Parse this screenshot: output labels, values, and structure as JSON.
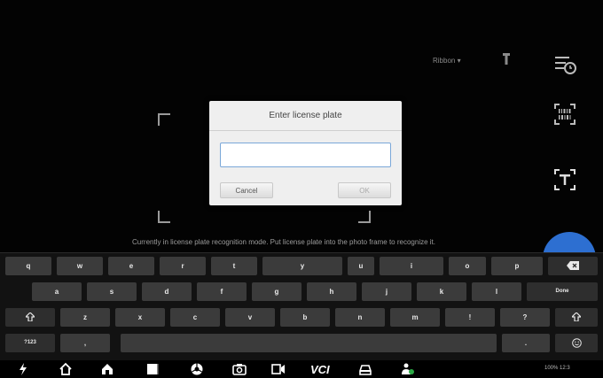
{
  "camera": {
    "mode_label": "Ribbon ▾",
    "hint": "Currently in license plate recognition mode. Put license plate into the photo frame to recognize it."
  },
  "dialog": {
    "title": "Enter license plate",
    "input_value": "",
    "input_placeholder": "",
    "cancel_label": "Cancel",
    "ok_label": "OK"
  },
  "keyboard": {
    "row1": [
      "q",
      "w",
      "e",
      "r",
      "t",
      "y",
      "u",
      "i",
      "o",
      "p"
    ],
    "row2": [
      "a",
      "s",
      "d",
      "f",
      "g",
      "h",
      "j",
      "k",
      "l"
    ],
    "row3": [
      "z",
      "x",
      "c",
      "v",
      "b",
      "n",
      "m",
      "!",
      "?"
    ],
    "done_label": "Done",
    "symbols_label": "?123",
    "comma_label": ",",
    "period_label": "."
  },
  "navbar": {
    "status": "100% 12:3",
    "vci_label": "VCI"
  },
  "colors": {
    "accent": "#2d6fd1",
    "dialog_bg": "#efefef",
    "key_bg": "#3b3b3b"
  }
}
